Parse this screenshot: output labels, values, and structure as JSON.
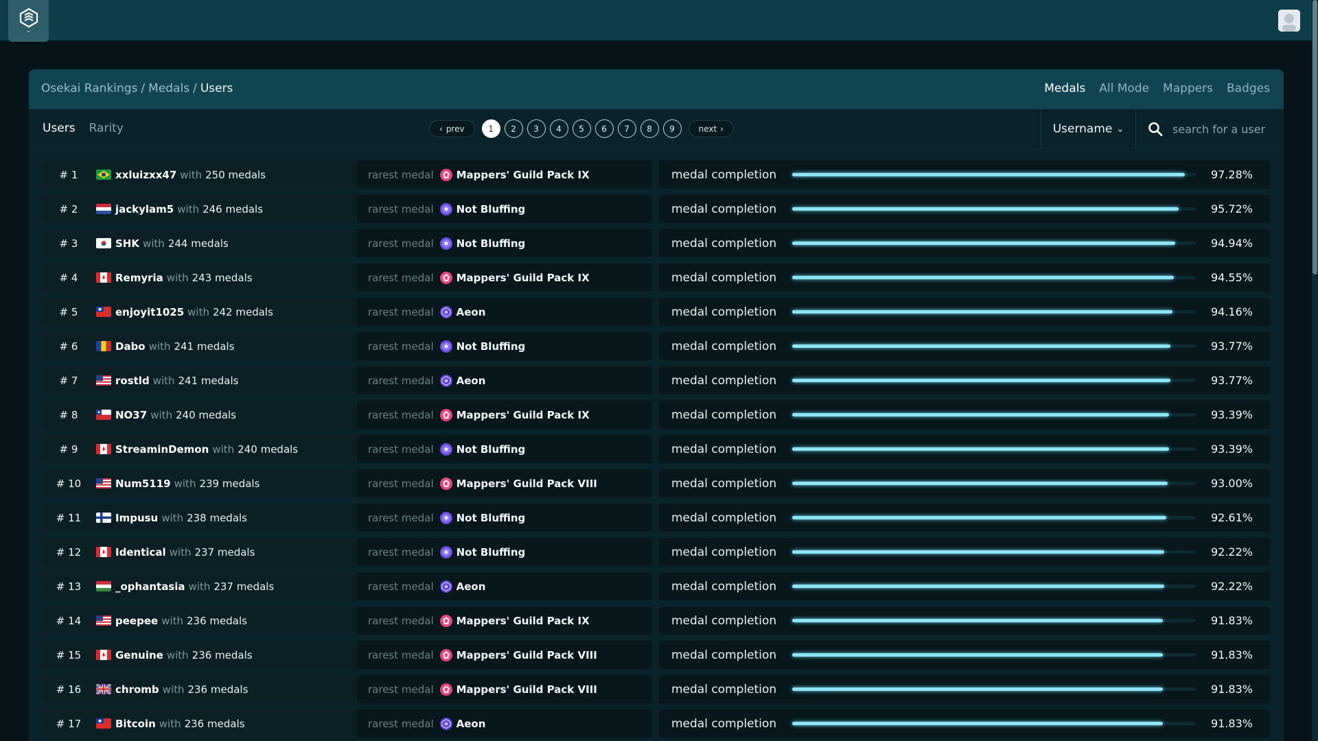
{
  "breadcrumb": {
    "part1": "Osekai Rankings",
    "sep1": "/",
    "part2": "Medals",
    "sep2": "/",
    "current": "Users"
  },
  "top_tabs": [
    "Medals",
    "All Mode",
    "Mappers",
    "Badges"
  ],
  "sub_tabs": [
    "Users",
    "Rarity"
  ],
  "pagination": {
    "prev": "prev",
    "next": "next",
    "pages": [
      "1",
      "2",
      "3",
      "4",
      "5",
      "6",
      "7",
      "8",
      "9"
    ],
    "current": "1"
  },
  "sort": {
    "label": "Username"
  },
  "search": {
    "placeholder": "search for a user"
  },
  "labels": {
    "with": "with",
    "medals_suffix": "medals",
    "rarest": "rarest medal",
    "completion": "medal completion"
  },
  "colors": {
    "topbar": "#0c3d48",
    "panel_header": "#0f4450",
    "progress": "#8ee4f5",
    "medal_pink": "#e8457a",
    "medal_purple": "#6a4ee0"
  },
  "rows": [
    {
      "rank": "# 1",
      "flag": "br",
      "user": "xxluizxx47",
      "medals": "250 medals",
      "rarest": "Mappers' Guild Pack IX",
      "icon": "pink",
      "pct": "97.28%",
      "progress": 0.9728
    },
    {
      "rank": "# 2",
      "flag": "nl",
      "user": "jackylam5",
      "medals": "246 medals",
      "rarest": "Not Bluffing",
      "icon": "purple",
      "pct": "95.72%",
      "progress": 0.9572
    },
    {
      "rank": "# 3",
      "flag": "kr",
      "user": "SHK",
      "medals": "244 medals",
      "rarest": "Not Bluffing",
      "icon": "purple",
      "pct": "94.94%",
      "progress": 0.9494
    },
    {
      "rank": "# 4",
      "flag": "ca",
      "user": "Remyria",
      "medals": "243 medals",
      "rarest": "Mappers' Guild Pack IX",
      "icon": "pink",
      "pct": "94.55%",
      "progress": 0.9455
    },
    {
      "rank": "# 5",
      "flag": "tw",
      "user": "enjoyit1025",
      "medals": "242 medals",
      "rarest": "Aeon",
      "icon": "violet",
      "pct": "94.16%",
      "progress": 0.9416
    },
    {
      "rank": "# 6",
      "flag": "ro",
      "user": "Dabo",
      "medals": "241 medals",
      "rarest": "Not Bluffing",
      "icon": "purple",
      "pct": "93.77%",
      "progress": 0.9377
    },
    {
      "rank": "# 7",
      "flag": "us",
      "user": "rostld",
      "medals": "241 medals",
      "rarest": "Aeon",
      "icon": "violet",
      "pct": "93.77%",
      "progress": 0.9377
    },
    {
      "rank": "# 8",
      "flag": "cl",
      "user": "NO37",
      "medals": "240 medals",
      "rarest": "Mappers' Guild Pack IX",
      "icon": "pink",
      "pct": "93.39%",
      "progress": 0.9339
    },
    {
      "rank": "# 9",
      "flag": "ca",
      "user": "StreaminDemon",
      "medals": "240 medals",
      "rarest": "Not Bluffing",
      "icon": "purple",
      "pct": "93.39%",
      "progress": 0.9339
    },
    {
      "rank": "# 10",
      "flag": "us",
      "user": "Num5119",
      "medals": "239 medals",
      "rarest": "Mappers' Guild Pack VIII",
      "icon": "pink",
      "pct": "93.00%",
      "progress": 0.93
    },
    {
      "rank": "# 11",
      "flag": "fi",
      "user": "Impusu",
      "medals": "238 medals",
      "rarest": "Not Bluffing",
      "icon": "purple",
      "pct": "92.61%",
      "progress": 0.9261
    },
    {
      "rank": "# 12",
      "flag": "ca",
      "user": "Identical",
      "medals": "237 medals",
      "rarest": "Not Bluffing",
      "icon": "purple",
      "pct": "92.22%",
      "progress": 0.9222
    },
    {
      "rank": "# 13",
      "flag": "hu",
      "user": "_ophantasia",
      "medals": "237 medals",
      "rarest": "Aeon",
      "icon": "violet",
      "pct": "92.22%",
      "progress": 0.9222
    },
    {
      "rank": "# 14",
      "flag": "us",
      "user": "peepee",
      "medals": "236 medals",
      "rarest": "Mappers' Guild Pack IX",
      "icon": "pink",
      "pct": "91.83%",
      "progress": 0.9183
    },
    {
      "rank": "# 15",
      "flag": "ca",
      "user": "Genuine",
      "medals": "236 medals",
      "rarest": "Mappers' Guild Pack VIII",
      "icon": "pink",
      "pct": "91.83%",
      "progress": 0.9183
    },
    {
      "rank": "# 16",
      "flag": "gb",
      "user": "chromb",
      "medals": "236 medals",
      "rarest": "Mappers' Guild Pack VIII",
      "icon": "pink",
      "pct": "91.83%",
      "progress": 0.9183
    },
    {
      "rank": "# 17",
      "flag": "tw",
      "user": "Bitcoin",
      "medals": "236 medals",
      "rarest": "Aeon",
      "icon": "violet",
      "pct": "91.83%",
      "progress": 0.9183
    }
  ]
}
